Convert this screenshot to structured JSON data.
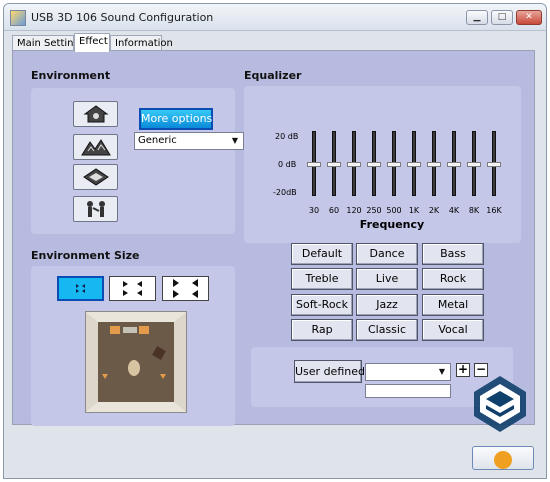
{
  "window": {
    "title": "USB 3D 106 Sound Configuration",
    "minimize_icon": "minimize-icon",
    "maximize_icon": "maximize-icon",
    "close_icon": "close-icon"
  },
  "tabs": [
    {
      "label": "Main Setting",
      "active": false
    },
    {
      "label": "Effect",
      "active": true
    },
    {
      "label": "Information",
      "active": false
    }
  ],
  "environment": {
    "title": "Environment",
    "buttons": [
      "house-icon",
      "mountains-icon",
      "cave-icon",
      "people-icon"
    ],
    "more_options_label": "More options",
    "preset_select_value": "Generic"
  },
  "environment_size": {
    "title": "Environment Size",
    "buttons": [
      "small-room-icon",
      "medium-room-icon",
      "large-room-icon"
    ],
    "selected_index": 0
  },
  "equalizer": {
    "title": "Equalizer",
    "db_labels": [
      "20",
      "0",
      "-20"
    ],
    "db_unit": "dB",
    "bands": [
      "30",
      "60",
      "120",
      "250",
      "500",
      "1K",
      "2K",
      "4K",
      "8K",
      "16K"
    ],
    "band_levels_db": [
      0,
      0,
      0,
      0,
      0,
      0,
      0,
      0,
      0,
      0
    ],
    "frequency_label": "Frequency",
    "presets": [
      "Default",
      "Dance",
      "Bass",
      "Treble",
      "Live",
      "Rock",
      "Soft-Rock",
      "Jazz",
      "Metal",
      "Rap",
      "Classic",
      "Vocal"
    ],
    "user_defined_label": "User defined",
    "user_select_value": "",
    "user_name_value": "",
    "add_symbol": "+",
    "remove_symbol": "−"
  },
  "colors": {
    "panel_bg": "#b8bbe0",
    "inner_bg": "#c4c7e7",
    "accent": "#16b8f2"
  }
}
